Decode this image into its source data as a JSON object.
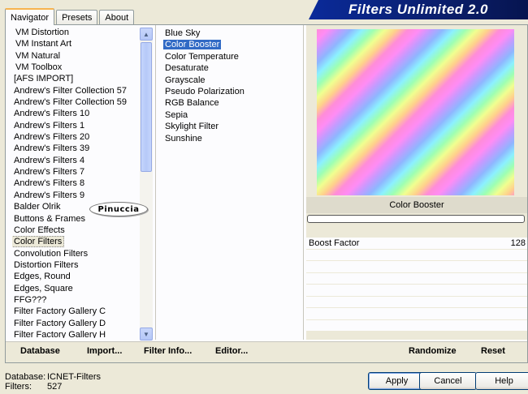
{
  "tabs": [
    {
      "label": "Navigator"
    },
    {
      "label": "Presets"
    },
    {
      "label": "About"
    }
  ],
  "title": "Filters Unlimited 2.0",
  "categories": [
    "VM Distortion",
    "VM Instant Art",
    "VM Natural",
    "VM Toolbox",
    "[AFS IMPORT]",
    "Andrew's Filter Collection 57",
    "Andrew's Filter Collection 59",
    "Andrew's Filters 10",
    "Andrew's Filters 1",
    "Andrew's Filters 20",
    "Andrew's Filters 39",
    "Andrew's Filters 4",
    "Andrew's Filters 7",
    "Andrew's Filters 8",
    "Andrew's Filters 9",
    "Balder Olrik",
    "Buttons & Frames",
    "Color Effects",
    "Color Filters",
    "Convolution Filters",
    "Distortion Filters",
    "Edges, Round",
    "Edges, Square",
    "FFG???",
    "Filter Factory Gallery C",
    "Filter Factory Gallery D",
    "Filter Factory Gallery H"
  ],
  "selected_category": "Color Filters",
  "filters": [
    "Blue Sky",
    "Color Booster",
    "Color Temperature",
    "Desaturate",
    "Grayscale",
    "Pseudo Polarization",
    "RGB Balance",
    "Sepia",
    "Skylight Filter",
    "Sunshine"
  ],
  "selected_filter": "Color Booster",
  "preview": {
    "filter_title": "Color Booster"
  },
  "params": [
    {
      "label": "Boost Factor",
      "value": "128"
    }
  ],
  "watermark": "Pinuccia",
  "bottom_bar": {
    "database": "Database",
    "import": "Import...",
    "filter_info": "Filter Info...",
    "editor": "Editor...",
    "randomize": "Randomize",
    "reset": "Reset"
  },
  "info": {
    "database_label": "Database:",
    "database_value": "ICNET-Filters",
    "filters_label": "Filters:",
    "filters_value": "527"
  },
  "dialog_buttons": {
    "apply": "Apply",
    "cancel": "Cancel",
    "help": "Help"
  }
}
